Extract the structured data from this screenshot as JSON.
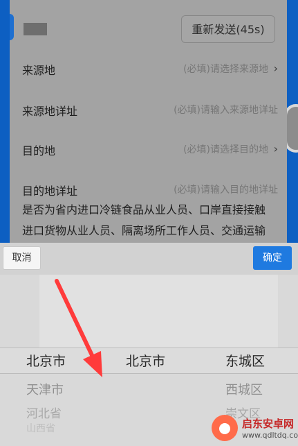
{
  "form": {
    "resend_button": "重新发送(45s)",
    "rows": [
      {
        "label": "来源地",
        "value": "(必填)请选择来源地"
      },
      {
        "label": "来源地详址",
        "value": "(必填)请输入来源地详址"
      },
      {
        "label": "目的地",
        "value": "(必填)请选择目的地"
      },
      {
        "label": "目的地详址",
        "value": "(必填)请输入目的地详址"
      }
    ],
    "notice_lines": [
      "是否为省内进口冷链食品从业人员、口岸直接接触",
      "进口货物从业人员、隔离场所工作人员、交通运输"
    ]
  },
  "picker": {
    "cancel_label": "取消",
    "confirm_label": "确定",
    "province": {
      "selected": "北京市",
      "below": [
        "天津市",
        "河北省",
        "山西省"
      ]
    },
    "city": {
      "selected": "北京市",
      "below": []
    },
    "district": {
      "selected": "东城区",
      "below": [
        "西城区",
        "崇文区"
      ]
    }
  },
  "watermark": {
    "title": "启东安卓网",
    "url": "www.qdltdq.com"
  },
  "icons": {
    "chevron": "chevron-right-icon",
    "arrow": "red-arrow-annotation"
  },
  "colors": {
    "accent_blue": "#1f7ae0",
    "arrow_red": "#ff3b3b",
    "watermark_red": "#c62828"
  }
}
